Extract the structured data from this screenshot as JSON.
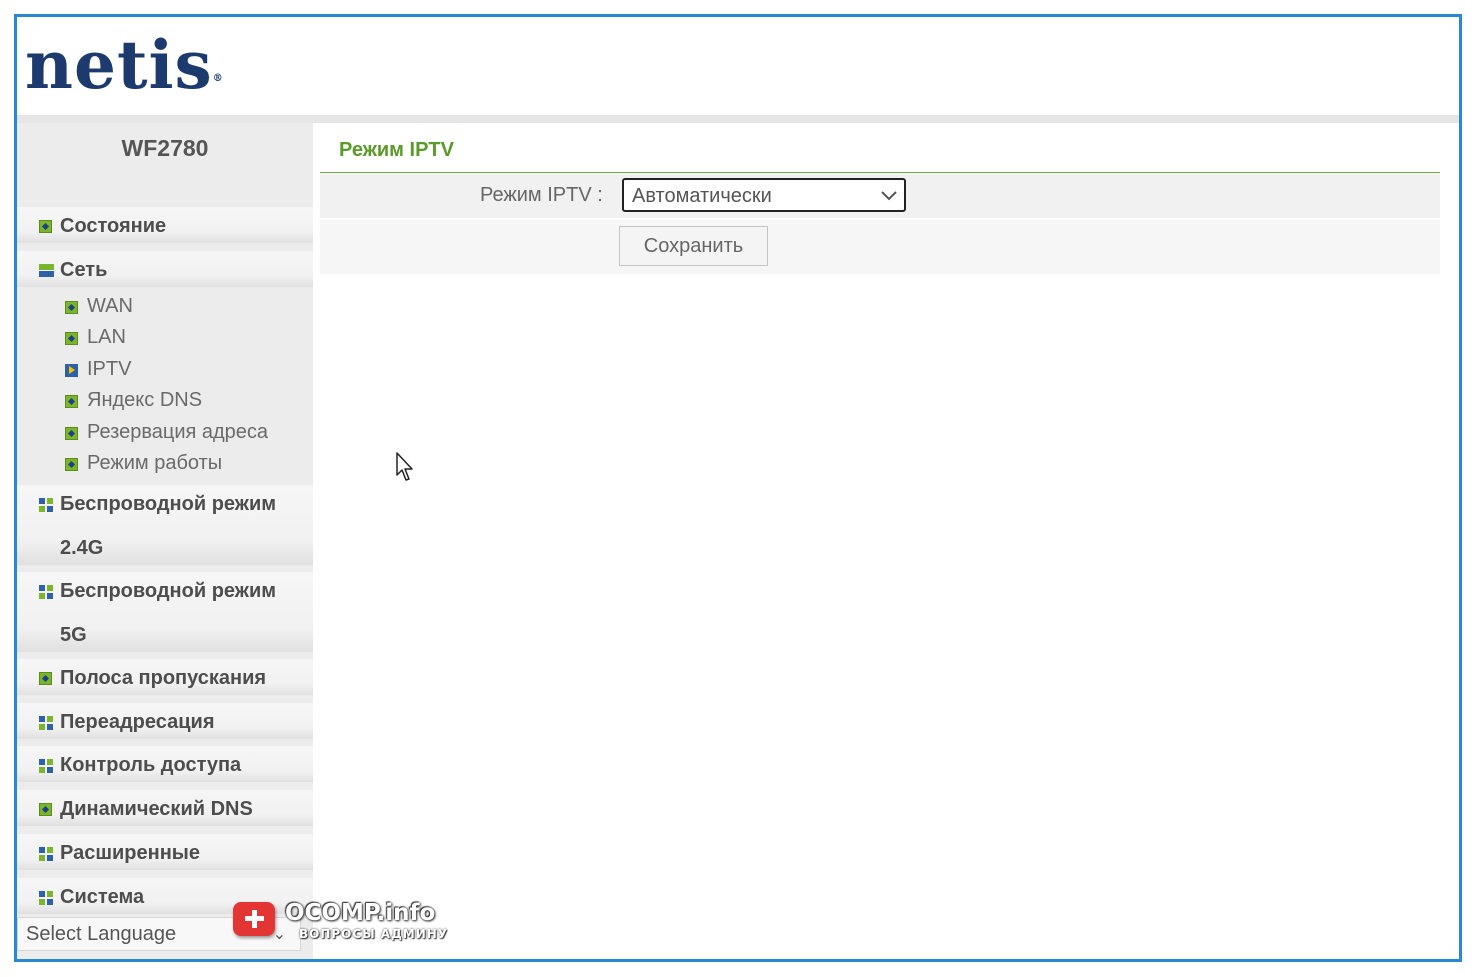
{
  "brand": {
    "logo_text": "netis",
    "model": "WF2780"
  },
  "sidebar": {
    "items": [
      {
        "label": "Состояние",
        "icon": "green-diamond-icon"
      },
      {
        "label": "Сеть",
        "icon": "expanded-minus-icon"
      },
      {
        "label": "Беспроводной режим",
        "label2": "2.4G",
        "icon": "grid-icon"
      },
      {
        "label": "Беспроводной режим",
        "label2": "5G",
        "icon": "grid-icon"
      },
      {
        "label": "Полоса пропускания",
        "icon": "green-diamond-icon"
      },
      {
        "label": "Переадресация",
        "icon": "grid-icon"
      },
      {
        "label": "Контроль доступа",
        "icon": "grid-icon"
      },
      {
        "label": "Динамический DNS",
        "icon": "green-diamond-icon"
      },
      {
        "label": "Расширенные",
        "icon": "grid-icon"
      },
      {
        "label": "Система",
        "icon": "grid-icon"
      }
    ],
    "subitems": [
      {
        "label": "WAN"
      },
      {
        "label": "LAN"
      },
      {
        "label": "IPTV",
        "active": true
      },
      {
        "label": "Яндекс DNS"
      },
      {
        "label": "Резервация адреса"
      },
      {
        "label": "Режим работы"
      }
    ],
    "language": "Select Language"
  },
  "content": {
    "title": "Режим IPTV",
    "field_label": "Режим IPTV :",
    "select_value": "Автоматически",
    "save_label": "Сохранить"
  },
  "watermark": {
    "title": "OCOMP.info",
    "subtitle": "ВОПРОСЫ АДМИНУ"
  },
  "colors": {
    "frame": "#2a86d6",
    "accent_green": "#5a9a2a",
    "logo": "#1c3a6e"
  }
}
